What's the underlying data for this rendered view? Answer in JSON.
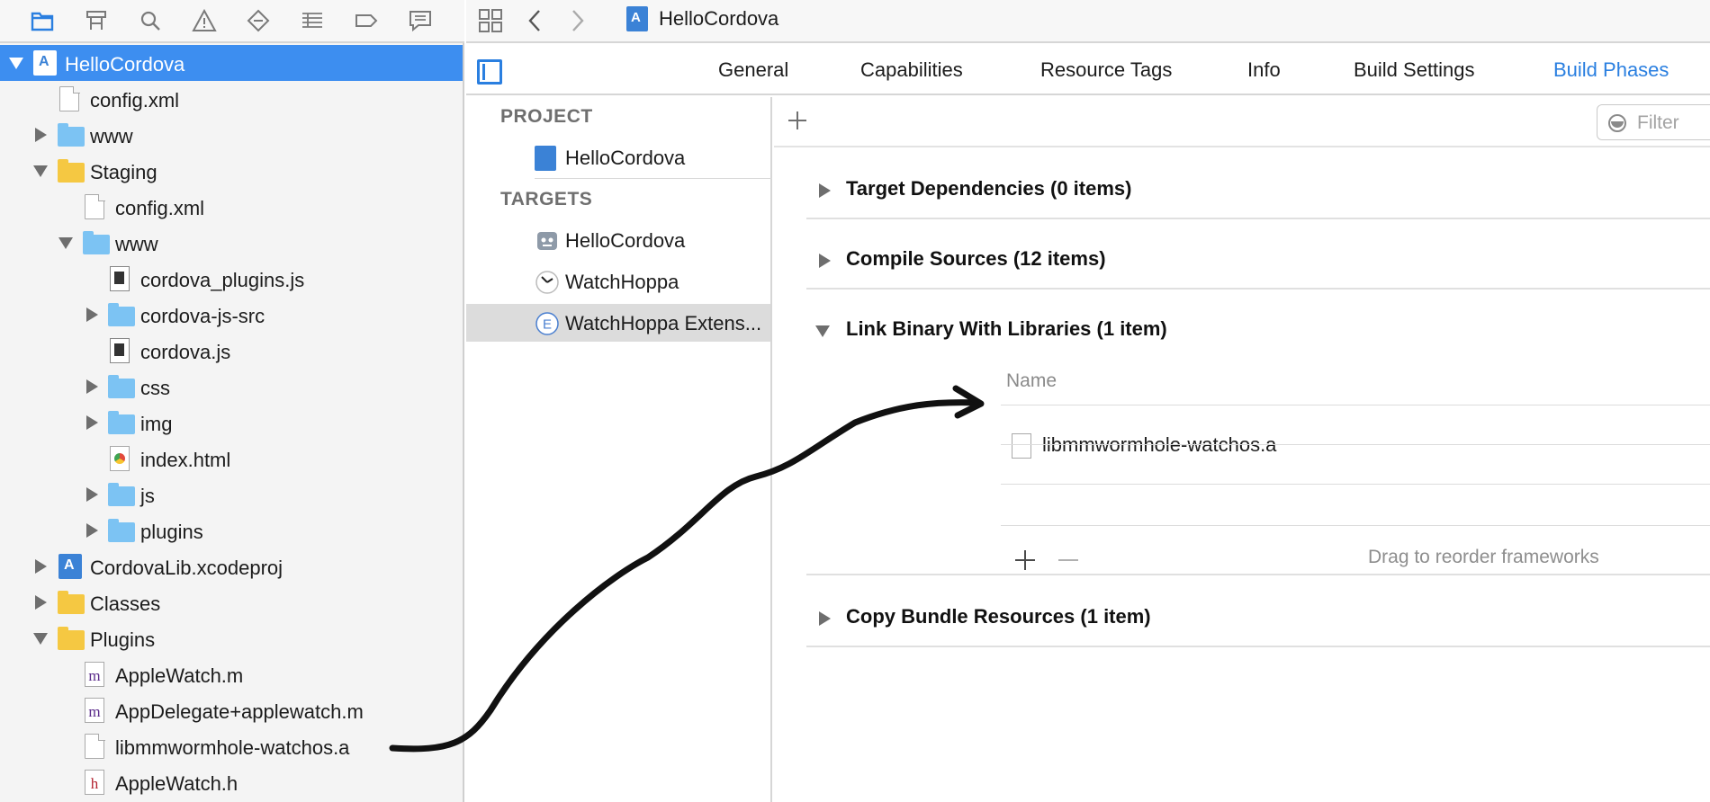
{
  "navigator": {
    "toolbar_icons": [
      "folder-icon",
      "hierarchy-icon",
      "search-icon",
      "warning-icon",
      "test-diamond-icon",
      "debug-list-icon",
      "breakpoint-icon",
      "report-icon"
    ],
    "items": [
      {
        "label": "HelloCordova",
        "icon": "project-icon",
        "expanded": true,
        "selected": true
      },
      {
        "label": "config.xml",
        "icon": "file-icon"
      },
      {
        "label": "www",
        "icon": "folder-icon"
      },
      {
        "label": "Staging",
        "icon": "folder-icon",
        "expanded": true
      },
      {
        "label": "config.xml",
        "icon": "file-icon"
      },
      {
        "label": "www",
        "icon": "folder-icon",
        "expanded": true
      },
      {
        "label": "cordova_plugins.js",
        "icon": "js-file-icon"
      },
      {
        "label": "cordova-js-src",
        "icon": "folder-icon"
      },
      {
        "label": "cordova.js",
        "icon": "js-file-icon"
      },
      {
        "label": "css",
        "icon": "folder-icon"
      },
      {
        "label": "img",
        "icon": "folder-icon"
      },
      {
        "label": "index.html",
        "icon": "html-file-icon"
      },
      {
        "label": "js",
        "icon": "folder-icon"
      },
      {
        "label": "plugins",
        "icon": "folder-icon"
      },
      {
        "label": "CordovaLib.xcodeproj",
        "icon": "project-icon"
      },
      {
        "label": "Classes",
        "icon": "folder-icon"
      },
      {
        "label": "Plugins",
        "icon": "folder-icon",
        "expanded": true
      },
      {
        "label": "AppleWatch.m",
        "icon": "m-file-icon"
      },
      {
        "label": "AppDelegate+applewatch.m",
        "icon": "m-file-icon"
      },
      {
        "label": "libmmwormhole-watchos.a",
        "icon": "file-icon"
      },
      {
        "label": "AppleWatch.h",
        "icon": "h-file-icon"
      }
    ]
  },
  "toolbar": {
    "breadcrumb_title": "HelloCordova"
  },
  "tabs": [
    {
      "label": "General"
    },
    {
      "label": "Capabilities"
    },
    {
      "label": "Resource Tags"
    },
    {
      "label": "Info"
    },
    {
      "label": "Build Settings"
    },
    {
      "label": "Build Phases",
      "active": true
    }
  ],
  "targets_pane": {
    "project_header": "PROJECT",
    "project_name": "HelloCordova",
    "targets_header": "TARGETS",
    "targets": [
      {
        "label": "HelloCordova",
        "icon": "app-target-icon"
      },
      {
        "label": "WatchHoppa",
        "icon": "watch-app-icon"
      },
      {
        "label": "WatchHoppa Extens...",
        "icon": "extension-icon",
        "selected": true
      }
    ]
  },
  "build_phases": {
    "filter_placeholder": "Filter",
    "phases": [
      {
        "title": "Target Dependencies (0 items)",
        "expanded": false
      },
      {
        "title": "Compile Sources (12 items)",
        "expanded": false
      },
      {
        "title": "Link Binary With Libraries (1 item)",
        "expanded": true
      },
      {
        "title": "Copy Bundle Resources (1 item)",
        "expanded": false
      }
    ],
    "libraries": {
      "column_header": "Name",
      "items": [
        "libmmwormhole-watchos.a"
      ],
      "drag_hint": "Drag to reorder frameworks"
    }
  },
  "colors": {
    "accent": "#2a7fe0",
    "selection": "#3d8ef0",
    "folder_blue": "#7cc3f3",
    "folder_yellow": "#f5c842"
  }
}
